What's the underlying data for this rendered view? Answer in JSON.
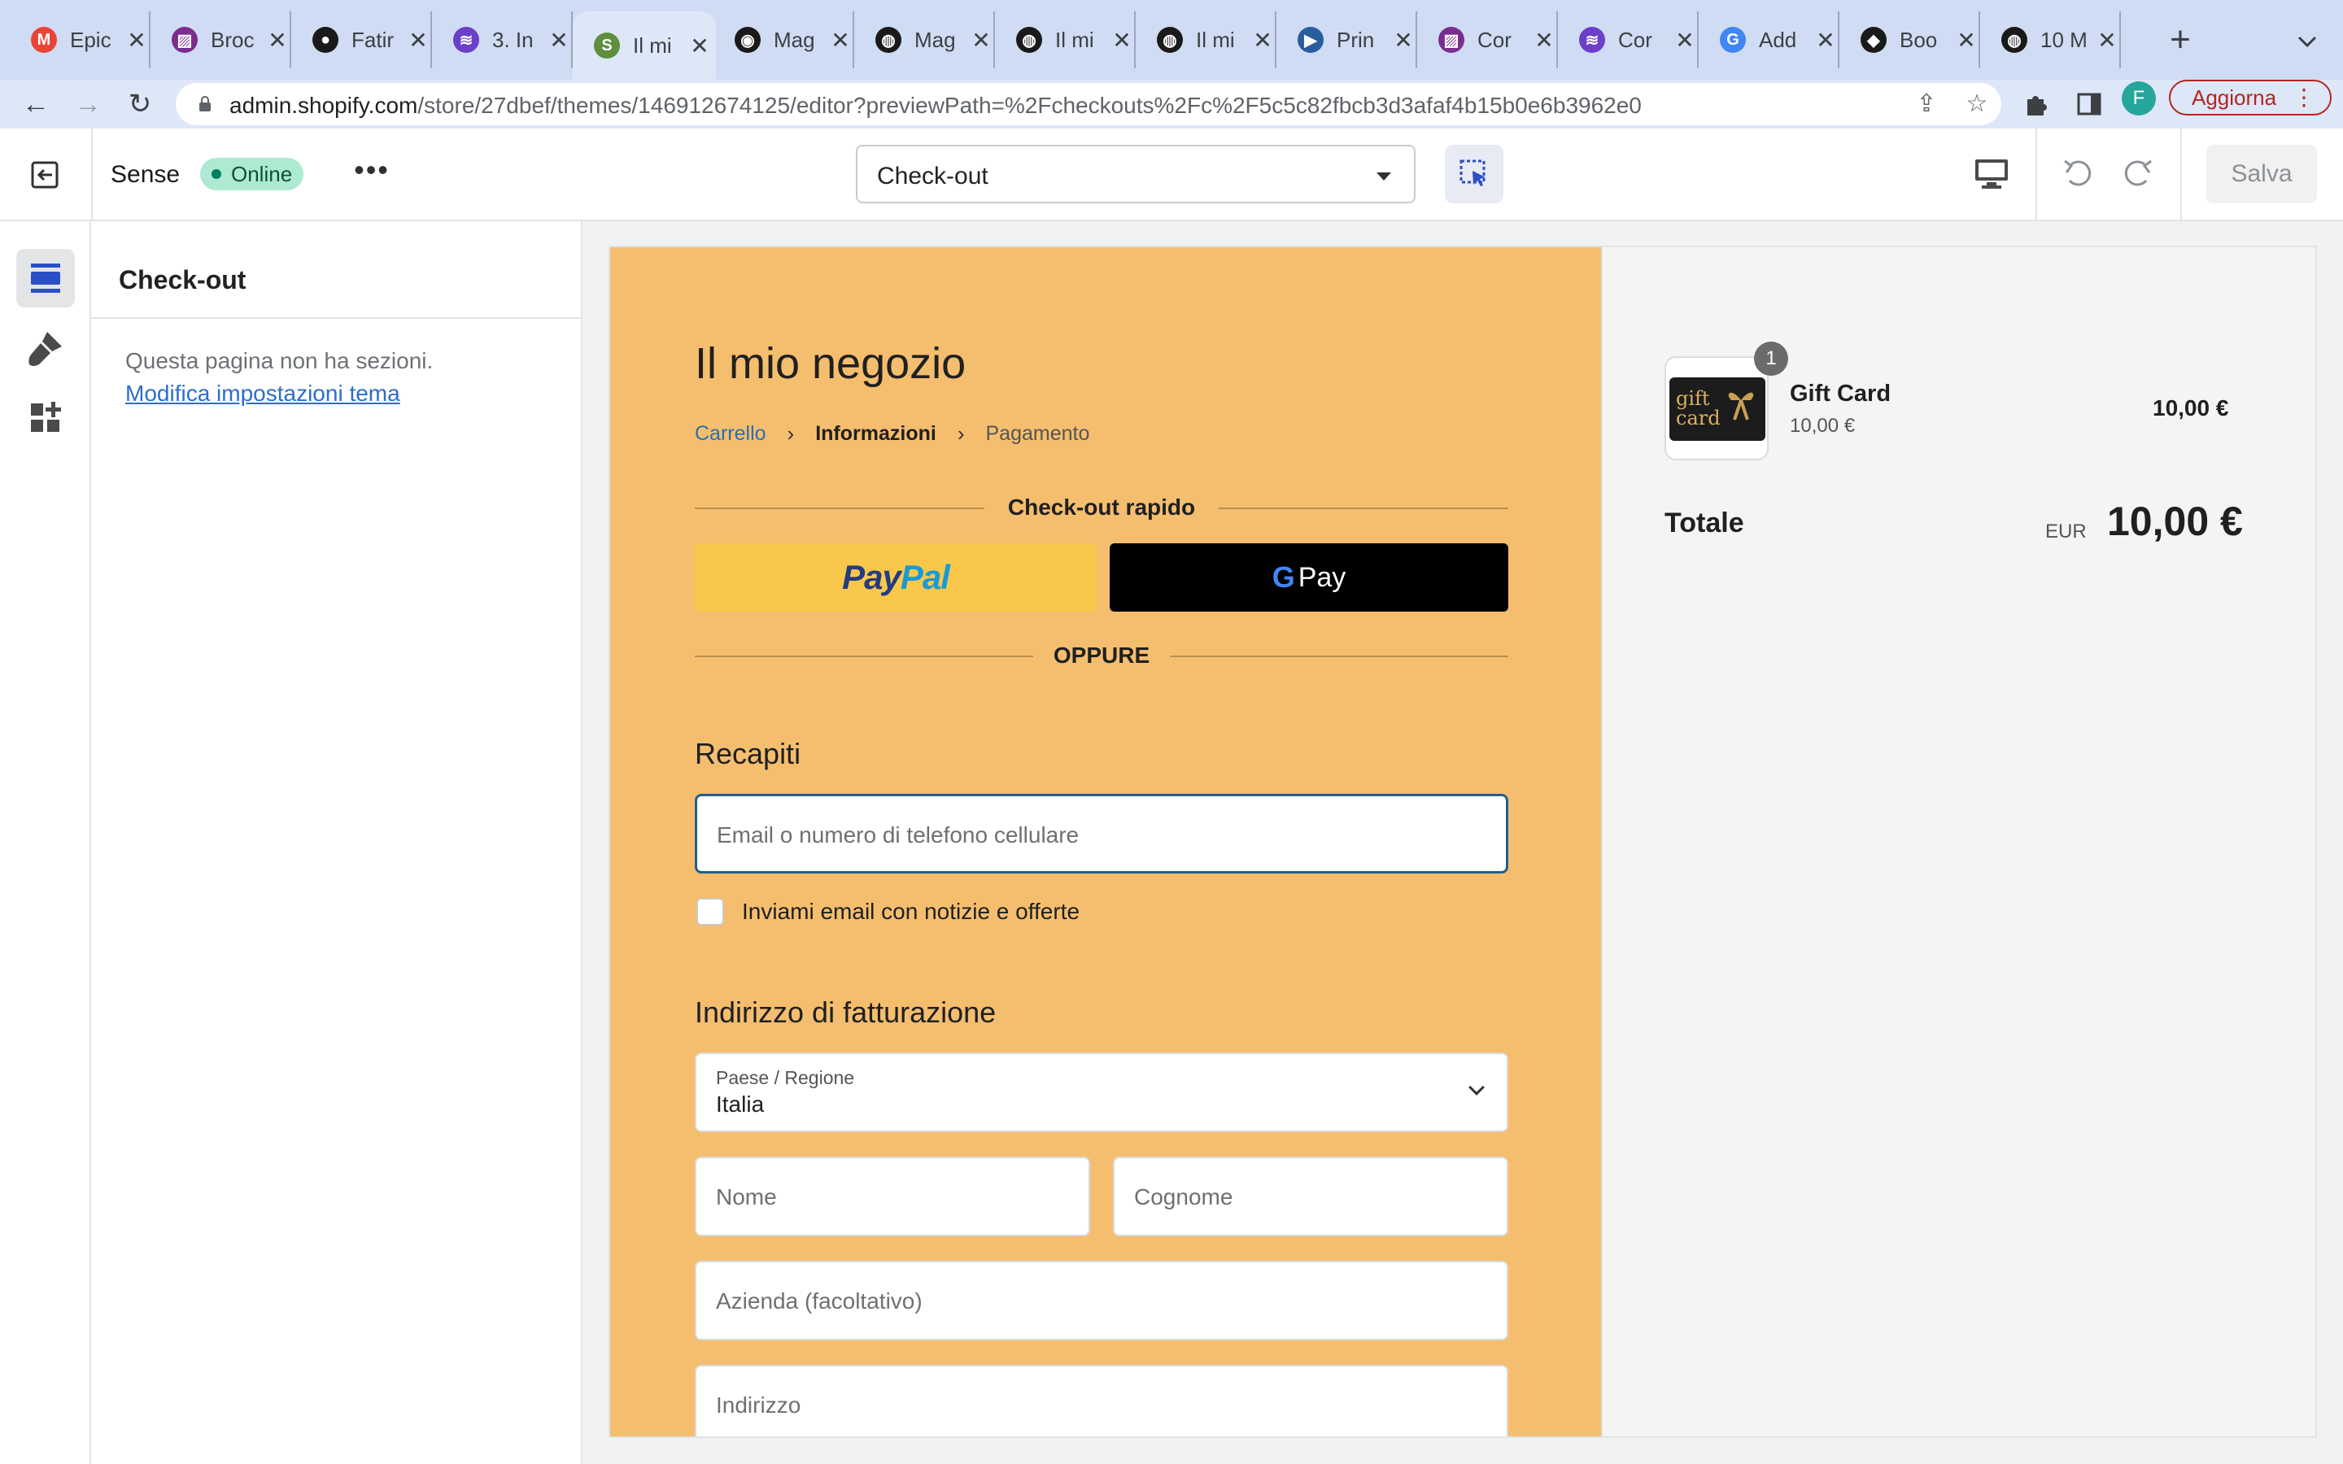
{
  "browser": {
    "tabs": [
      {
        "title": "Epic",
        "icon": "gmail-icon",
        "color": "#ea4335"
      },
      {
        "title": "Broc",
        "icon": "stripes-icon",
        "color": "#7b2d8e"
      },
      {
        "title": "Fatir",
        "icon": "github-icon",
        "color": "#1a1a1a"
      },
      {
        "title": "3. In",
        "icon": "linear-icon",
        "color": "#6b3fc8"
      },
      {
        "title": "Il mi",
        "icon": "shopify-icon",
        "color": "#5e8e3e",
        "active": true
      },
      {
        "title": "Mag",
        "icon": "magento-icon",
        "color": "#1a1a1a"
      },
      {
        "title": "Mag",
        "icon": "globe-icon",
        "color": "#1a1a1a"
      },
      {
        "title": "Il mi",
        "icon": "globe-icon",
        "color": "#1a1a1a"
      },
      {
        "title": "Il mi",
        "icon": "globe-icon",
        "color": "#1a1a1a"
      },
      {
        "title": "Prin",
        "icon": "play-icon",
        "color": "#2a5d9f"
      },
      {
        "title": "Cor",
        "icon": "stripes-icon",
        "color": "#7b2d8e"
      },
      {
        "title": "Cor",
        "icon": "linear-icon",
        "color": "#6b3fc8"
      },
      {
        "title": "Add",
        "icon": "google-icon",
        "color": "#4285f4"
      },
      {
        "title": "Boo",
        "icon": "diamond-icon",
        "color": "#1a1a1a"
      },
      {
        "title": "10 M",
        "icon": "globe-icon",
        "color": "#1a1a1a"
      }
    ],
    "url_host": "admin.shopify.com",
    "url_path": "/store/27dbef/themes/146912674125/editor?previewPath=%2Fcheckouts%2Fc%2F5c5c82fbcb3d3afaf4b15b0e6b3962e0",
    "profile_initial": "F",
    "update_label": "Aggiorna"
  },
  "editor": {
    "theme_name": "Sense",
    "status": "Online",
    "page_select": "Check-out",
    "save_label": "Salva"
  },
  "sidebar": {
    "title": "Check-out",
    "empty_text": "Questa pagina non ha sezioni.",
    "link_text": "Modifica impostazioni tema"
  },
  "checkout": {
    "store_name": "Il mio negozio",
    "breadcrumb": [
      "Carrello",
      "Informazioni",
      "Pagamento"
    ],
    "express_title": "Check-out rapido",
    "paypal_label": [
      "Pay",
      "Pal"
    ],
    "gpay_label": "Pay",
    "or_label": "OPPURE",
    "contact_title": "Recapiti",
    "email_placeholder": "Email o numero di telefono cellulare",
    "newsletter_label": "Inviami email con notizie e offerte",
    "billing_title": "Indirizzo di fatturazione",
    "country_label": "Paese / Regione",
    "country_value": "Italia",
    "first_name_placeholder": "Nome",
    "last_name_placeholder": "Cognome",
    "company_placeholder": "Azienda (facoltativo)",
    "address_placeholder": "Indirizzo",
    "accent_color": "#f5be6e"
  },
  "summary": {
    "product_image_text": [
      "gift",
      "card"
    ],
    "quantity": "1",
    "product_name": "Gift Card",
    "unit_price": "10,00 €",
    "line_total": "10,00 €",
    "total_label": "Totale",
    "currency": "EUR",
    "total_amount": "10,00 €"
  }
}
